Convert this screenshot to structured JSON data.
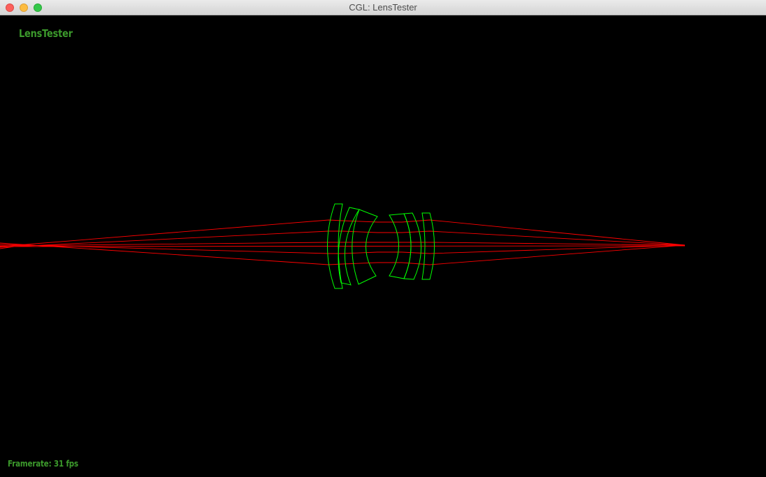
{
  "window": {
    "title": "CGL: LensTester"
  },
  "hud": {
    "app_name": "LensTester",
    "framerate_label": "Framerate: 31 fps"
  },
  "colors": {
    "rays": "#ff0000",
    "lens_outline": "#00ff00",
    "hud_text": "#3c9a2c",
    "background": "#000000"
  },
  "icons": {
    "close": "close-icon",
    "minimize": "minimize-icon",
    "maximize": "maximize-icon"
  }
}
